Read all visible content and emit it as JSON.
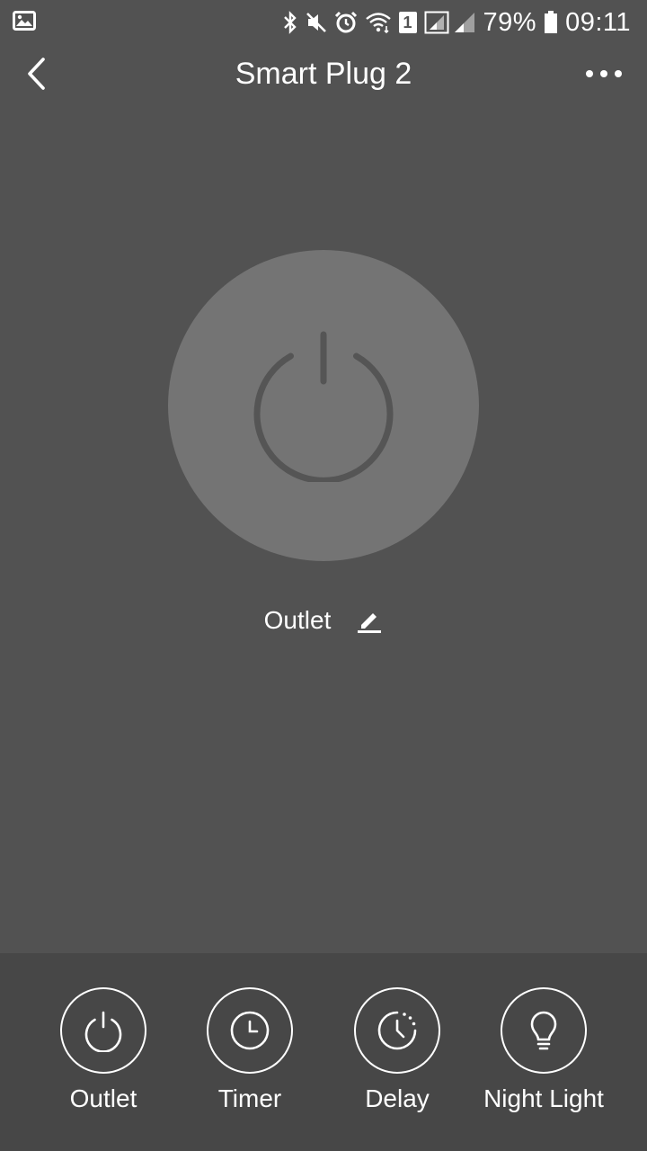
{
  "status_bar": {
    "battery": "79%",
    "time": "09:11",
    "sim_badge": "1",
    "icons": [
      "image-icon",
      "bluetooth-icon",
      "mute-icon",
      "alarm-icon",
      "wifi-icon",
      "signal-icon",
      "battery-icon"
    ]
  },
  "header": {
    "title": "Smart Plug 2"
  },
  "main": {
    "outlet_name": "Outlet",
    "power_state": "off"
  },
  "bottom_nav": {
    "items": [
      {
        "label": "Outlet",
        "icon": "power-icon"
      },
      {
        "label": "Timer",
        "icon": "clock-icon"
      },
      {
        "label": "Delay",
        "icon": "delay-clock-icon"
      },
      {
        "label": "Night Light",
        "icon": "lightbulb-icon"
      }
    ]
  },
  "colors": {
    "background": "#525252",
    "bottom_bar": "#474747",
    "power_circle": "#747474",
    "power_symbol": "#555555",
    "text": "#ffffff"
  }
}
